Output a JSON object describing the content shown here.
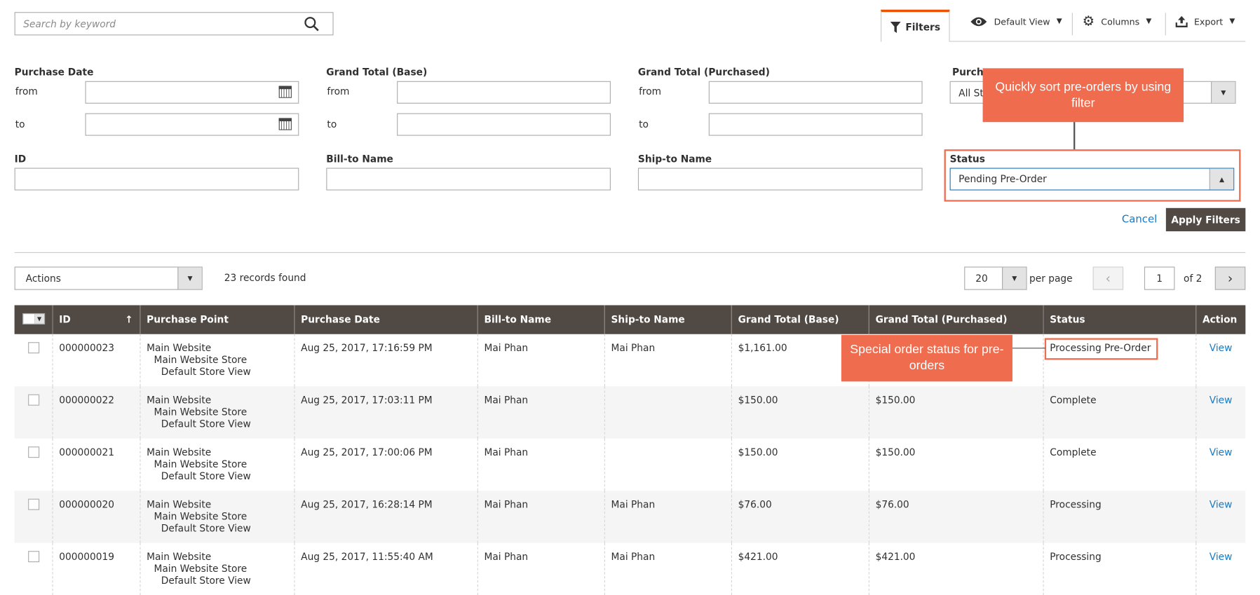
{
  "search": {
    "placeholder": "Search by keyword"
  },
  "toolbar": {
    "filters": "Filters",
    "default_view": "Default View",
    "columns": "Columns",
    "export": "Export"
  },
  "filters": {
    "purchase_date": "Purchase Date",
    "grand_total_base": "Grand Total (Base)",
    "grand_total_purchased": "Grand Total (Purchased)",
    "purchase_point": "Purcha",
    "purchase_point_value": "All St",
    "from": "from",
    "to": "to",
    "id": "ID",
    "bill_to": "Bill-to Name",
    "ship_to": "Ship-to Name",
    "status": "Status",
    "status_value": "Pending Pre-Order",
    "cancel": "Cancel",
    "apply": "Apply Filters"
  },
  "callouts": {
    "filter": "Quickly sort pre-orders by using filter",
    "status": "Special order status for pre-orders"
  },
  "grid": {
    "actions": "Actions",
    "records": "23 records found",
    "per_page_value": "20",
    "per_page": "per page",
    "page": "1",
    "of": "of 2"
  },
  "colors": {
    "accent": "#eb5202",
    "header": "#514943",
    "callout": "#f06c4f",
    "link": "#1979c3"
  },
  "table": {
    "headers": [
      "ID",
      "Purchase Point",
      "Purchase Date",
      "Bill-to Name",
      "Ship-to Name",
      "Grand Total (Base)",
      "Grand Total (Purchased)",
      "Status",
      "Action"
    ],
    "rows": [
      {
        "id": "000000023",
        "p1": "Main Website",
        "p2": "Main Website Store",
        "p3": "Default Store View",
        "date": "Aug 25, 2017, 17:16:59 PM",
        "bill": "Mai Phan",
        "ship": "Mai Phan",
        "base": "$1,161.00",
        "purchased": "",
        "status": "Processing Pre-Order",
        "action": "View"
      },
      {
        "id": "000000022",
        "p1": "Main Website",
        "p2": "Main Website Store",
        "p3": "Default Store View",
        "date": "Aug 25, 2017, 17:03:11 PM",
        "bill": "Mai Phan",
        "ship": "",
        "base": "$150.00",
        "purchased": "$150.00",
        "status": "Complete",
        "action": "View"
      },
      {
        "id": "000000021",
        "p1": "Main Website",
        "p2": "Main Website Store",
        "p3": "Default Store View",
        "date": "Aug 25, 2017, 17:00:06 PM",
        "bill": "Mai Phan",
        "ship": "",
        "base": "$150.00",
        "purchased": "$150.00",
        "status": "Complete",
        "action": "View"
      },
      {
        "id": "000000020",
        "p1": "Main Website",
        "p2": "Main Website Store",
        "p3": "Default Store View",
        "date": "Aug 25, 2017, 16:28:14 PM",
        "bill": "Mai Phan",
        "ship": "Mai Phan",
        "base": "$76.00",
        "purchased": "$76.00",
        "status": "Processing",
        "action": "View"
      },
      {
        "id": "000000019",
        "p1": "Main Website",
        "p2": "Main Website Store",
        "p3": "Default Store View",
        "date": "Aug 25, 2017, 11:55:40 AM",
        "bill": "Mai Phan",
        "ship": "Mai Phan",
        "base": "$421.00",
        "purchased": "$421.00",
        "status": "Processing",
        "action": "View"
      }
    ]
  }
}
